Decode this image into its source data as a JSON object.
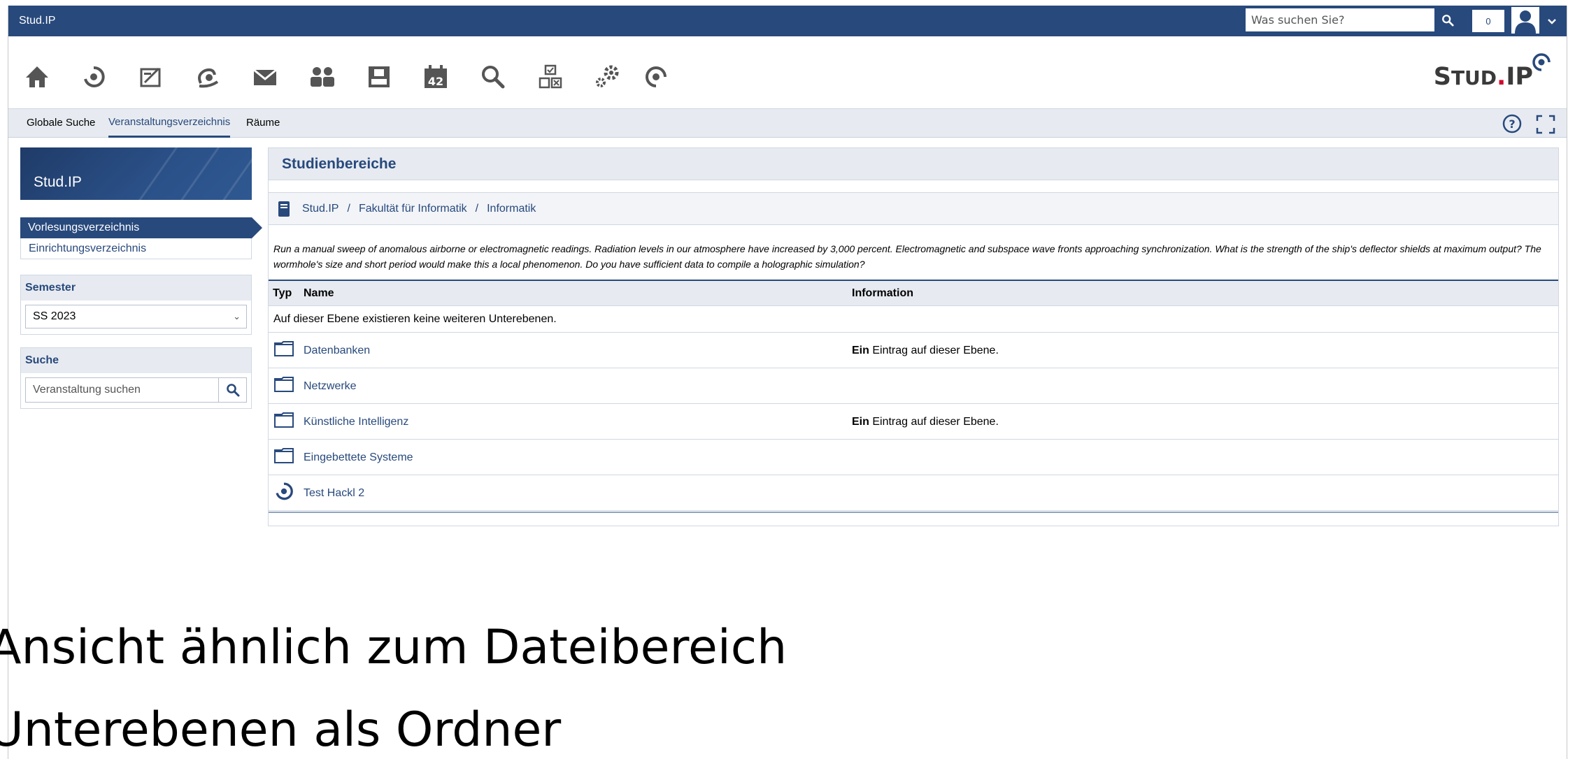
{
  "topbar": {
    "brand": "Stud.IP",
    "search_placeholder": "Was suchen Sie?",
    "notification_count": "0"
  },
  "navbar": {
    "icons": [
      "home-icon",
      "seminar-icon",
      "schedule-icon",
      "community-icon",
      "messages-icon",
      "people-icon",
      "profile-icon",
      "calendar-icon",
      "search-icon",
      "tools-icon",
      "admin-icon",
      "studip-icon"
    ],
    "calendar_day": "42",
    "logo_first": "S",
    "logo_small": "TUD",
    "logo_dot": ".",
    "logo_last": "IP"
  },
  "tabs": [
    {
      "label": "Globale Suche"
    },
    {
      "label": "Veranstaltungsverzeichnis"
    },
    {
      "label": "Räume"
    }
  ],
  "sidebar": {
    "title": "Stud.IP",
    "nav": [
      {
        "label": "Vorlesungsverzeichnis"
      },
      {
        "label": "Einrichtungsverzeichnis"
      }
    ],
    "semester": {
      "title": "Semester",
      "value": "SS 2023"
    },
    "search": {
      "title": "Suche",
      "placeholder": "Veranstaltung suchen"
    }
  },
  "main": {
    "title": "Studienbereiche",
    "breadcrumb": [
      "Stud.IP",
      "Fakultät für Informatik",
      "Informatik"
    ],
    "description": "Run a manual sweep of anomalous airborne or electromagnetic readings. Radiation levels in our atmosphere have increased by 3,000 percent. Electromagnetic and subspace wave fronts approaching synchronization. What is the strength of the ship's deflector shields at maximum output? The wormhole's size and short period would make this a local phenomenon. Do you have sufficient data to compile a holographic simulation?",
    "table": {
      "headers": {
        "type": "Typ",
        "name": "Name",
        "info": "Information"
      },
      "empty_message": "Auf dieser Ebene existieren keine weiteren Unterebenen.",
      "rows": [
        {
          "icon": "folder-icon",
          "name": "Datenbanken",
          "info_bold": "Ein",
          "info_rest": " Eintrag auf dieser Ebene."
        },
        {
          "icon": "folder-icon",
          "name": "Netzwerke",
          "info_bold": "",
          "info_rest": ""
        },
        {
          "icon": "folder-icon",
          "name": "Künstliche Intelligenz",
          "info_bold": "Ein",
          "info_rest": " Eintrag auf dieser Ebene."
        },
        {
          "icon": "folder-icon",
          "name": "Eingebettete Systeme",
          "info_bold": "",
          "info_rest": ""
        },
        {
          "icon": "course-icon",
          "name": "Test Hackl 2",
          "info_bold": "",
          "info_rest": ""
        }
      ]
    }
  },
  "slide": {
    "line1": "Ansicht ähnlich zum Dateibereich",
    "line2": "Unterebenen als Ordner"
  },
  "colors": {
    "brand_blue": "#28497c",
    "light_bg": "#e7ebf1",
    "logo_red": "#d1082c"
  }
}
